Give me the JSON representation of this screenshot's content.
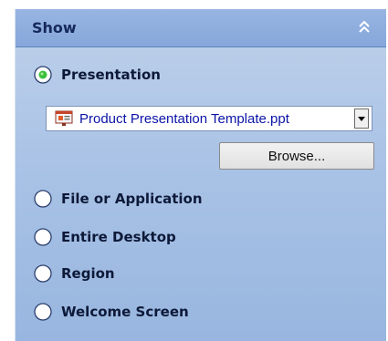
{
  "panel": {
    "title": "Show",
    "collapse_icon": "chevron-double-up-icon"
  },
  "options": [
    {
      "label": "Presentation",
      "selected": true
    },
    {
      "label": "File or Application",
      "selected": false
    },
    {
      "label": "Entire Desktop",
      "selected": false
    },
    {
      "label": "Region",
      "selected": false
    },
    {
      "label": "Welcome Screen",
      "selected": false
    }
  ],
  "presentation_dropdown": {
    "value": "Product Presentation Template.ppt",
    "icon": "powerpoint-file-icon"
  },
  "browse_button": {
    "label": "Browse..."
  },
  "colors": {
    "header": "#86a7db",
    "panel": "#aac3e6",
    "radio_selected": "#3cbf3c",
    "dropdown_text": "#0b14a6"
  }
}
